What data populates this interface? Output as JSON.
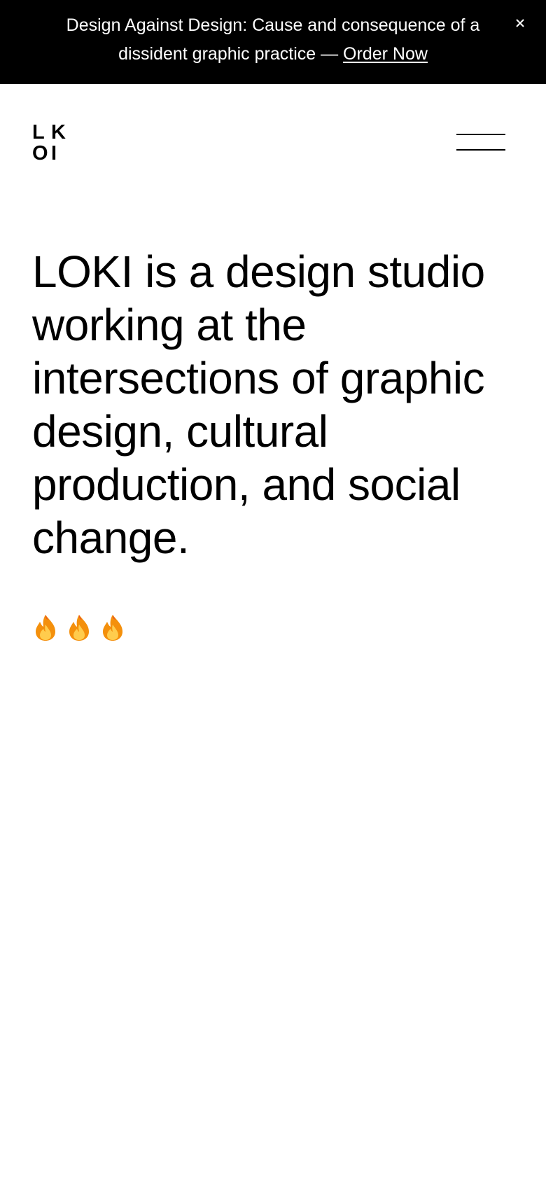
{
  "announcement": {
    "text": "Design Against Design: Cause and consequence of a dissident graphic practice —",
    "link_label": "Order Now",
    "close_icon": "close-icon"
  },
  "header": {
    "logo_letters": [
      "L",
      "K",
      "O",
      "I"
    ],
    "menu_icon": "hamburger-menu-icon"
  },
  "hero": {
    "text": "LOKI is a design studio working at the intersections of graphic design, cultural production, and social change."
  },
  "emojis": [
    {
      "icon": "fire-emoji-icon"
    },
    {
      "icon": "fire-emoji-icon"
    },
    {
      "icon": "fire-emoji-icon"
    }
  ],
  "colors": {
    "banner_bg": "#000000",
    "banner_text": "#ffffff",
    "page_bg": "#ffffff",
    "text": "#000000",
    "flame_outer": "#f4900c",
    "flame_inner": "#ffcc4d",
    "flame_red": "#e53935"
  }
}
